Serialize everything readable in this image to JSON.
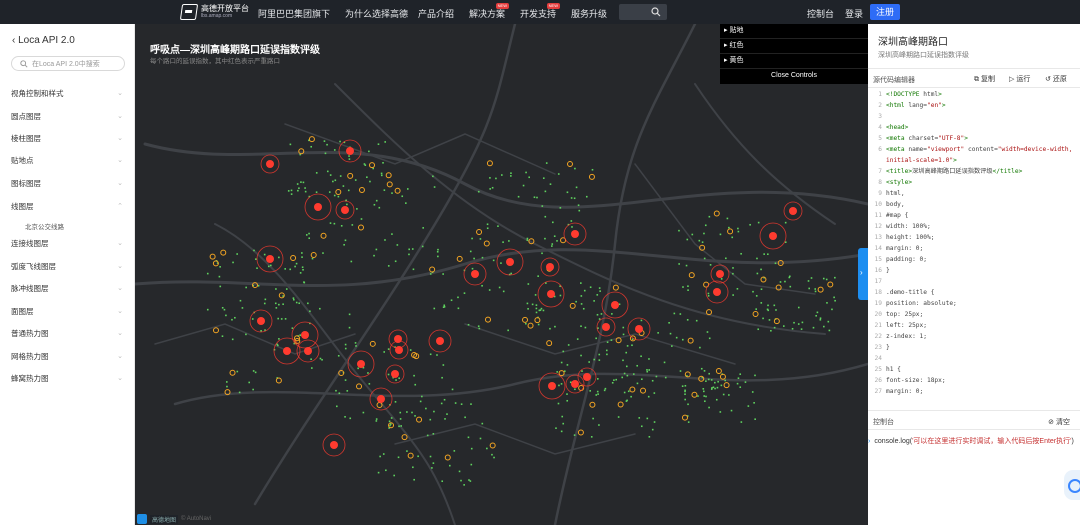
{
  "topbar": {
    "brand": "高德开放平台",
    "brand_sub": "lbs.amap.com",
    "group": "阿里巴巴集团旗下",
    "nav": [
      {
        "label": "为什么选择高德",
        "new": false
      },
      {
        "label": "产品介绍",
        "new": false
      },
      {
        "label": "解决方案",
        "new": true
      },
      {
        "label": "开发支持",
        "new": true
      },
      {
        "label": "服务升级",
        "new": false
      }
    ],
    "new_badge": "NEW",
    "console": "控制台",
    "login": "登录",
    "register": "注册"
  },
  "sidebar": {
    "back_title": "Loca API 2.0",
    "search_placeholder": "在Loca API 2.0中搜索",
    "items": [
      {
        "label": "视角控制和样式"
      },
      {
        "label": "圆点图层"
      },
      {
        "label": "棱柱图层"
      },
      {
        "label": "贴地点"
      },
      {
        "label": "图标图层"
      },
      {
        "label": "线图层",
        "expanded": true,
        "sub": "北京公交线路"
      },
      {
        "label": "连接线图层"
      },
      {
        "label": "弧度飞线图层"
      },
      {
        "label": "脉冲线图层"
      },
      {
        "label": "面图层"
      },
      {
        "label": "普通热力图"
      },
      {
        "label": "网格热力图"
      },
      {
        "label": "蜂窝热力图"
      }
    ]
  },
  "map": {
    "title": "呼吸点—深圳高峰期路口延误指数评级",
    "subtitle": "每个路口的延误指数，其中红色表示严重路口",
    "attribution": "高德地图",
    "attribution_extra": "© AutoNavi",
    "controls": [
      "贴地",
      "红色",
      "黄色"
    ],
    "close_controls": "Close Controls",
    "colors": {
      "red": "#ff3b2f",
      "yellow": "#f5a623",
      "green": "#5fd35f",
      "bg": "#26282b"
    }
  },
  "right": {
    "title": "深圳高峰期路口",
    "subtitle": "深圳高峰期路口延误指数评级",
    "editor_label": "源代码编辑器",
    "copy": "复制",
    "run": "运行",
    "restore": "还原",
    "code": [
      "<!DOCTYPE html>",
      "<html lang=\"en\">",
      "",
      "<head>",
      "    <meta charset=\"UTF-8\">",
      "    <meta name=\"viewport\" content=\"width=device-width, initial-scale=1.0\">",
      "    <title>深圳高峰期路口延误指数评级</title>",
      "    <style>",
      "        html,",
      "        body,",
      "        #map {",
      "            width: 100%;",
      "            height: 100%;",
      "            margin: 0;",
      "            padding: 0;",
      "        }",
      "",
      "        .demo-title {",
      "            position: absolute;",
      "            top: 25px;",
      "            left: 25px;",
      "            z-index: 1;",
      "        }",
      "",
      "        h1 {",
      "            font-size: 18px;",
      "            margin: 0;"
    ],
    "console_label": "控制台",
    "clear": "清空",
    "console_cmd": "console.log(",
    "console_str": "'可以在这里进行实时调试，输入代码后按Enter执行'",
    "console_end": ")"
  }
}
